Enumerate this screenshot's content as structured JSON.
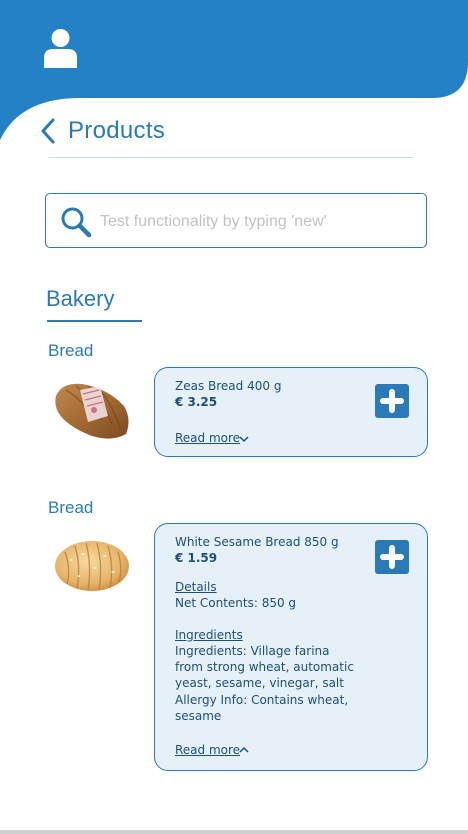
{
  "header": {
    "title": "Products",
    "brand_color": "#2a7ab8"
  },
  "search": {
    "placeholder": "Test functionality by typing 'new'",
    "value": ""
  },
  "category": {
    "title": "Bakery"
  },
  "products": [
    {
      "subcategory": "Bread",
      "name": "Zeas Bread 400 g",
      "price": "€ 3.25",
      "read_more": "Read more",
      "expanded": false
    },
    {
      "subcategory": "Bread",
      "name": "White Sesame Bread 850 g",
      "price": "€ 1.59",
      "details_label": "Details",
      "net_contents": "Net Contents:  850 g",
      "ingredients_label": "Ingredients",
      "ingredients_lines": [
        "Ingredients:  Village farina",
        "from strong wheat, automatic",
        "yeast, sesame, vinegar, salt"
      ],
      "allergy_lines": [
        "Allergy Info:  Contains wheat,",
        "sesame"
      ],
      "read_more": "Read more",
      "expanded": true
    }
  ],
  "icons": {
    "avatar": "user-icon",
    "back": "chevron-left-icon",
    "search": "search-icon",
    "add": "plus-icon",
    "collapse": "chevron-up-icon",
    "expand": "chevron-down-icon"
  }
}
